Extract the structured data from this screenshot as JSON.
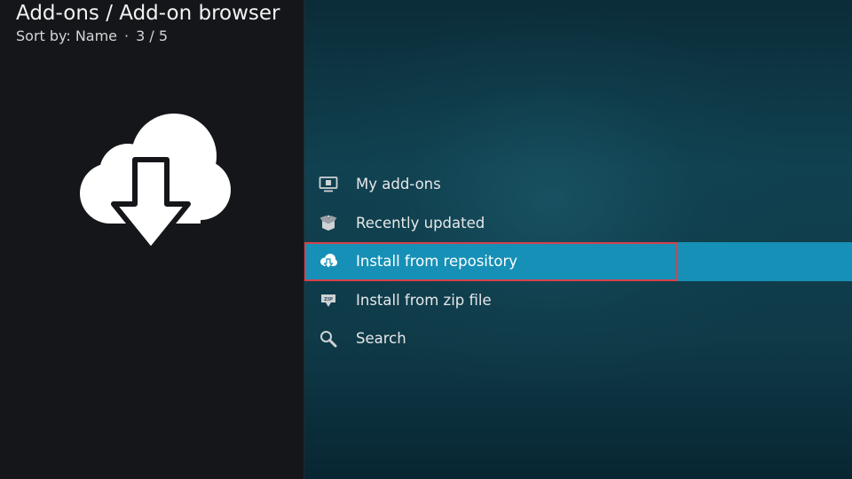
{
  "header": {
    "title": "Add-ons / Add-on browser",
    "sort_label": "Sort by: Name",
    "separator": "·",
    "position": "3 / 5"
  },
  "preview": {
    "icon": "cloud-download-icon"
  },
  "menu": {
    "items": [
      {
        "label": "My add-ons",
        "icon": "monitor-box-icon"
      },
      {
        "label": "Recently updated",
        "icon": "open-box-icon"
      },
      {
        "label": "Install from repository",
        "icon": "cloud-download-icon"
      },
      {
        "label": "Install from zip file",
        "icon": "zip-box-icon"
      },
      {
        "label": "Search",
        "icon": "search-icon"
      }
    ],
    "selected_index": 2
  },
  "colors": {
    "focus_background": "#1690b6",
    "highlight_outline": "#d84049",
    "left_panel": "#141619",
    "right_panel": "#104150"
  }
}
